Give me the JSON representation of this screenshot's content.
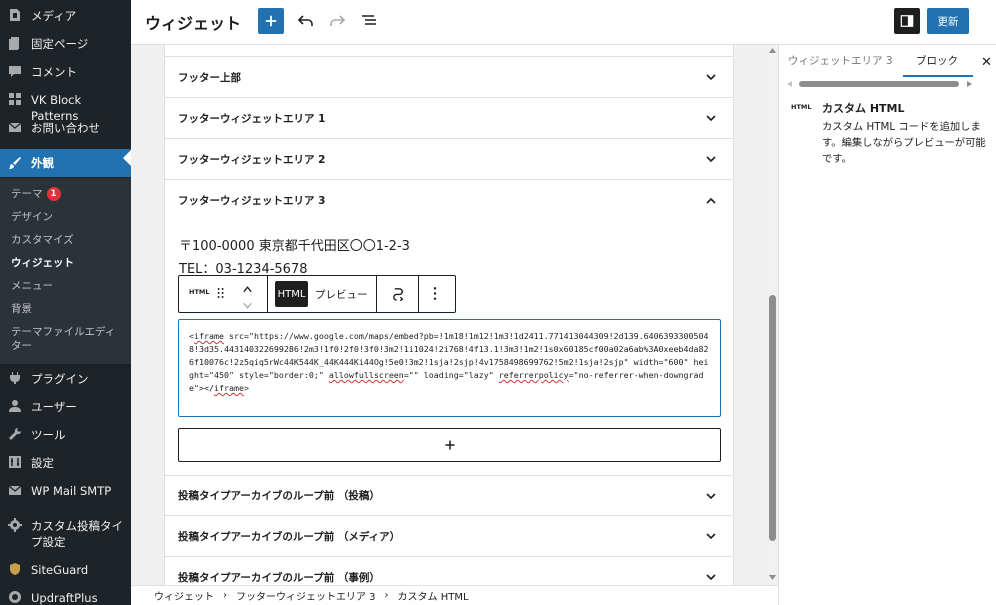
{
  "admin_menu": {
    "items": [
      {
        "name": "media",
        "label": "メディア",
        "icon": "media-icon"
      },
      {
        "name": "pages",
        "label": "固定ページ",
        "icon": "page-icon"
      },
      {
        "name": "comments",
        "label": "コメント",
        "icon": "comment-icon"
      },
      {
        "name": "vk-block-patterns",
        "label": "VK Block Patterns",
        "icon": "grid-icon"
      },
      {
        "name": "contact",
        "label": "お問い合わせ",
        "icon": "mail-icon"
      },
      {
        "name": "appearance",
        "label": "外観",
        "icon": "brush-icon"
      },
      {
        "name": "plugins",
        "label": "プラグイン",
        "icon": "plugin-icon"
      },
      {
        "name": "users",
        "label": "ユーザー",
        "icon": "user-icon"
      },
      {
        "name": "tools",
        "label": "ツール",
        "icon": "wrench-icon"
      },
      {
        "name": "settings",
        "label": "設定",
        "icon": "settings-icon"
      },
      {
        "name": "wp-mail-smtp",
        "label": "WP Mail SMTP",
        "icon": "envelope-icon"
      },
      {
        "name": "custom-post-type",
        "label": "カスタム投稿タイプ設定",
        "icon": "gear-icon"
      },
      {
        "name": "siteguard",
        "label": "SiteGuard",
        "icon": "shield-icon"
      },
      {
        "name": "updraftplus",
        "label": "UpdraftPlus",
        "icon": "updraft-icon"
      }
    ],
    "submenu": [
      {
        "label": "テーマ",
        "badge": "1"
      },
      {
        "label": "デザイン"
      },
      {
        "label": "カスタマイズ"
      },
      {
        "label": "ウィジェット",
        "current": true
      },
      {
        "label": "メニュー"
      },
      {
        "label": "背景"
      },
      {
        "label": "テーマファイルエディター"
      }
    ]
  },
  "header": {
    "title": "ウィジェット",
    "update_label": "更新"
  },
  "widget_areas": [
    {
      "title": "フッター上部",
      "expanded": false
    },
    {
      "title": "フッターウィジェットエリア 1",
      "expanded": false
    },
    {
      "title": "フッターウィジェットエリア 2",
      "expanded": false
    },
    {
      "title": "フッターウィジェットエリア 3",
      "expanded": true
    },
    {
      "title": "投稿タイプアーカイブのループ前 （投稿）",
      "expanded": false
    },
    {
      "title": "投稿タイプアーカイブのループ前 （メディア）",
      "expanded": false
    },
    {
      "title": "投稿タイプアーカイブのループ前 （事例）",
      "expanded": false
    }
  ],
  "area_content": {
    "address": "〒100-0000 東京都千代田区〇〇1-2-3",
    "tel": "TEL：03-1234-5678"
  },
  "block_toolbar": {
    "block_type_label": "HTML",
    "html_tab": "HTML",
    "preview_tab": "プレビュー"
  },
  "html_block": {
    "code_parts": [
      "<",
      "iframe",
      " src=\"https://www.google.com/maps/embed?pb=!1m18!1m12!1m3!1d2411.771413044309!2d139.64063933005048!3d35.443140322699286!2m3!1f0!2f0!3f0!3m2!1i1024!2i768!4f13.1!3m3!1m2!1s0x60185cf00a02a6ab%3A0xeeb4da826f10076c!2z5qiq5rWc44K544K_44K444Ki44Og!5e0!3m2!1sja!2sjp!4v1758498699762!5m2!1sja!2sjp\" width=\"600\" height=\"450\" style=\"border:0;\" ",
      "allowfullscreen",
      "=\"\" loading=\"lazy\" ",
      "referrerpolicy",
      "=\"no-referrer-when-downgrade\"></",
      "iframe",
      ">"
    ]
  },
  "settings_panel": {
    "tab_area": "ウィジェットエリア 3",
    "tab_block": "ブロック",
    "block_tag": "HTML",
    "block_name": "カスタム HTML",
    "block_description": "カスタム HTML コードを追加します。編集しながらプレビューが可能です。"
  },
  "breadcrumb": [
    "ウィジェット",
    "フッターウィジェットエリア 3",
    "カスタム HTML"
  ],
  "colors": {
    "admin_bg": "#1d2327",
    "accent": "#2271b1",
    "badge": "#d63638"
  }
}
